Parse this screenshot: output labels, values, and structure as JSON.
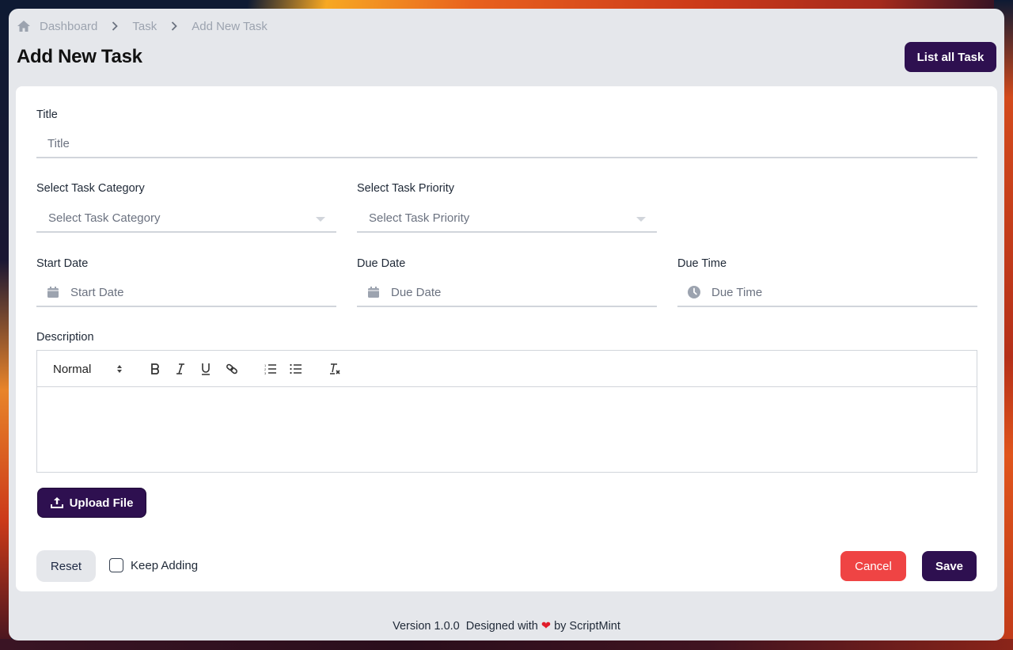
{
  "breadcrumb": {
    "items": [
      "Dashboard",
      "Task",
      "Add New Task"
    ]
  },
  "header": {
    "title": "Add New Task",
    "list_button": "List all Task"
  },
  "form": {
    "title": {
      "label": "Title",
      "placeholder": "Title"
    },
    "category": {
      "label": "Select Task Category",
      "placeholder": "Select Task Category"
    },
    "priority": {
      "label": "Select Task Priority",
      "placeholder": "Select Task Priority"
    },
    "start_date": {
      "label": "Start Date",
      "placeholder": "Start Date",
      "icon": "calendar-icon"
    },
    "due_date": {
      "label": "Due Date",
      "placeholder": "Due Date",
      "icon": "calendar-icon"
    },
    "due_time": {
      "label": "Due Time",
      "placeholder": "Due Time",
      "icon": "clock-icon"
    },
    "description": {
      "label": "Description",
      "format_select": "Normal",
      "toolbar": [
        "bold",
        "italic",
        "underline",
        "link",
        "ordered-list",
        "bullet-list",
        "clear-format"
      ],
      "value": ""
    },
    "upload_button": "Upload File",
    "reset_button": "Reset",
    "keep_adding": {
      "label": "Keep Adding",
      "checked": false
    },
    "cancel_button": "Cancel",
    "save_button": "Save"
  },
  "footer": {
    "version": "Version 1.0.0",
    "designed_with": "Designed with",
    "heart": "❤",
    "by": "by ScriptMint"
  },
  "colors": {
    "primary": "#2e1050",
    "danger": "#ef4444",
    "page_bg": "#e5e7eb"
  }
}
